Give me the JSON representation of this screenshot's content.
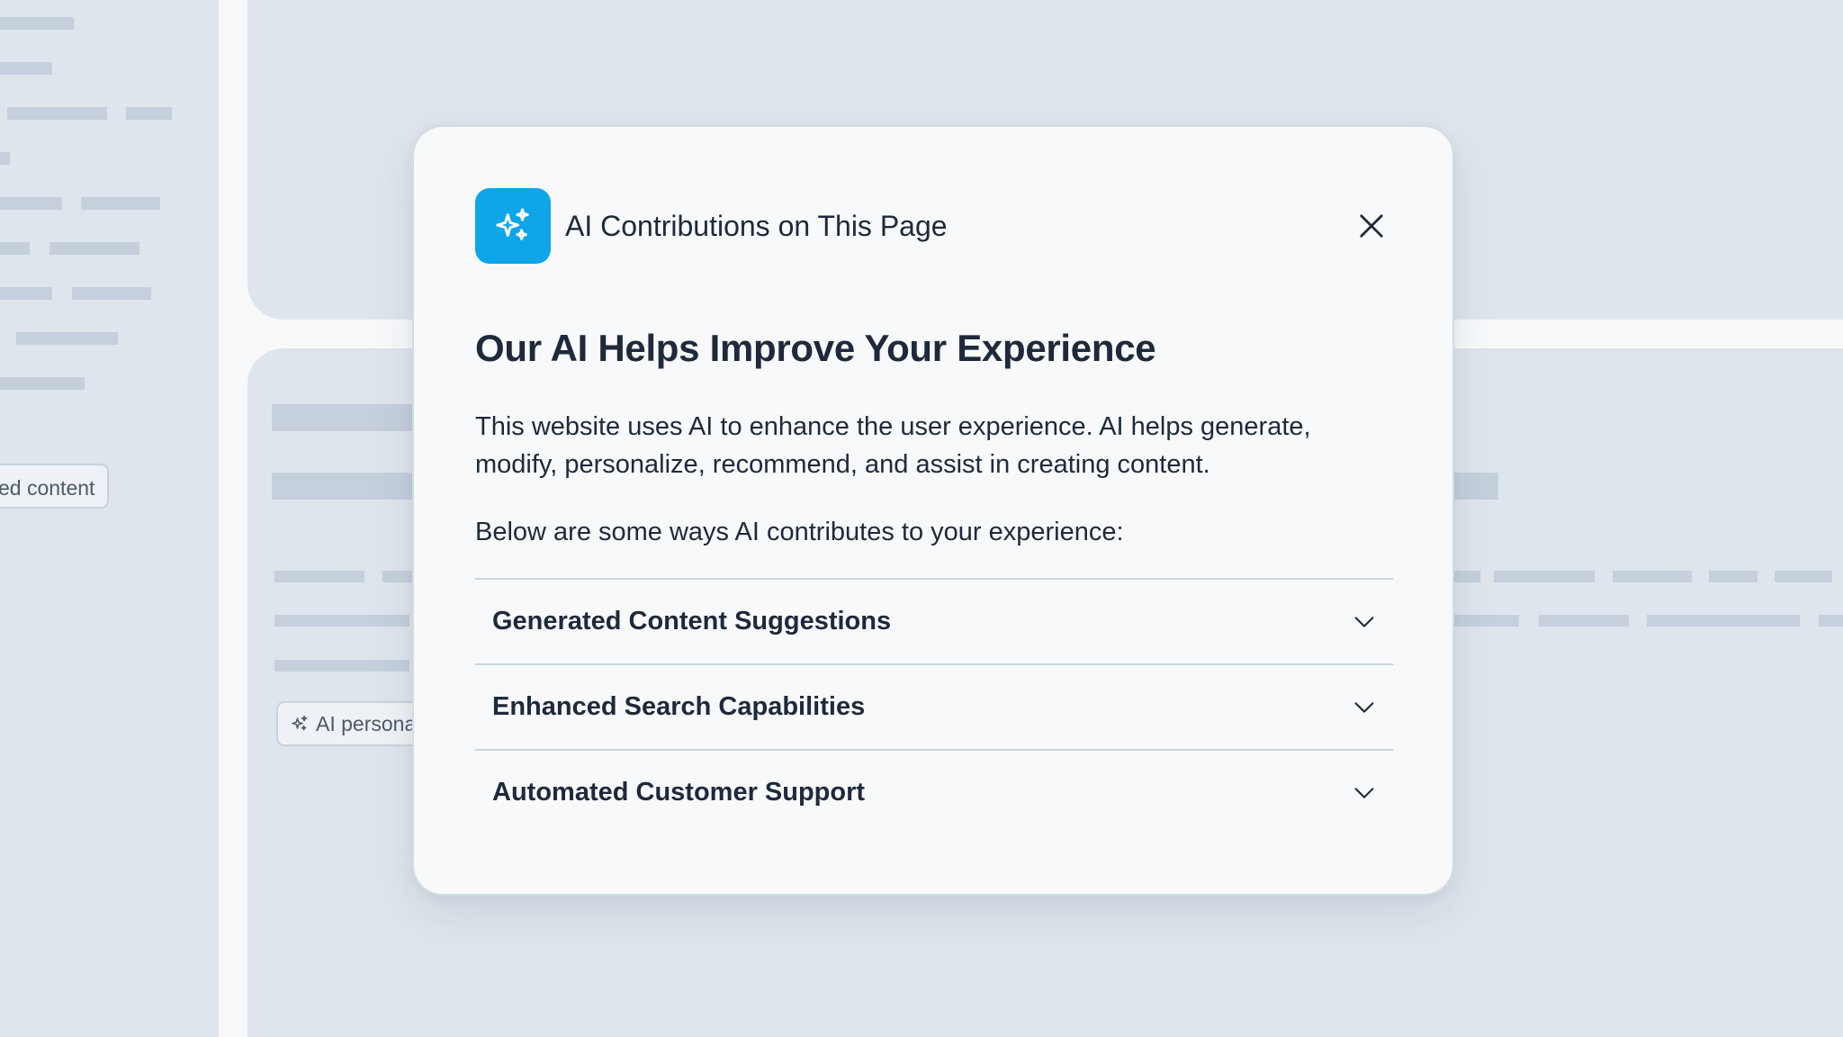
{
  "background": {
    "left_chip_text": "ed content",
    "main_chip_text": "AI persona"
  },
  "modal": {
    "header_label": "AI Contributions on This Page",
    "header_icon": "sparkles-icon",
    "close_icon": "close-icon",
    "title": "Our AI Helps Improve Your Experience",
    "paragraph_1": "This website uses AI to enhance the user experience. AI helps generate, modify, personalize, recommend, and assist in creating content.",
    "paragraph_2": "Below are some ways AI contributes to your experience:",
    "accordion": [
      {
        "title": "Generated Content Suggestions",
        "expanded": false
      },
      {
        "title": "Enhanced Search Capabilities",
        "expanded": false
      },
      {
        "title": "Automated Customer Support",
        "expanded": false
      }
    ]
  },
  "colors": {
    "accent": "#0ea5e9",
    "text": "#1e293b",
    "background_panel": "#dfe5ec",
    "modal_bg": "#f7f9fb",
    "divider": "#cbd5e1"
  }
}
